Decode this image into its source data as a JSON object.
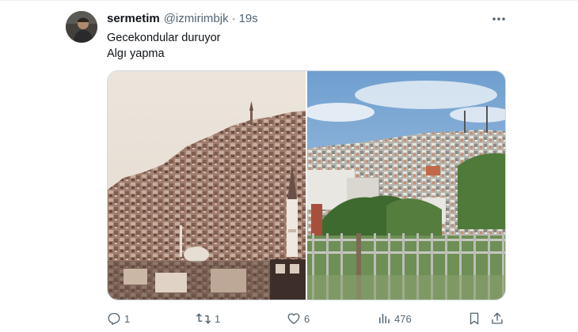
{
  "tweet": {
    "display_name": "sermetim",
    "handle": "@izmirimbjk",
    "separator": "·",
    "time": "19s",
    "lines": [
      "Gecekondular duruyor",
      "Algı yapma"
    ]
  },
  "media": {
    "left_image": "sepia-hillside-houses-photo",
    "right_image": "modern-hillside-city-photo"
  },
  "actions": {
    "reply_count": "1",
    "retweet_count": "1",
    "like_count": "6",
    "view_count": "476"
  },
  "icons": {
    "more": "more-horizontal-icon",
    "reply": "reply-icon",
    "retweet": "retweet-icon",
    "like": "heart-icon",
    "views": "views-chart-icon",
    "bookmark": "bookmark-icon",
    "share": "share-icon"
  },
  "colors": {
    "text_primary": "#0f1419",
    "text_secondary": "#536471",
    "border": "#cfd9de"
  }
}
